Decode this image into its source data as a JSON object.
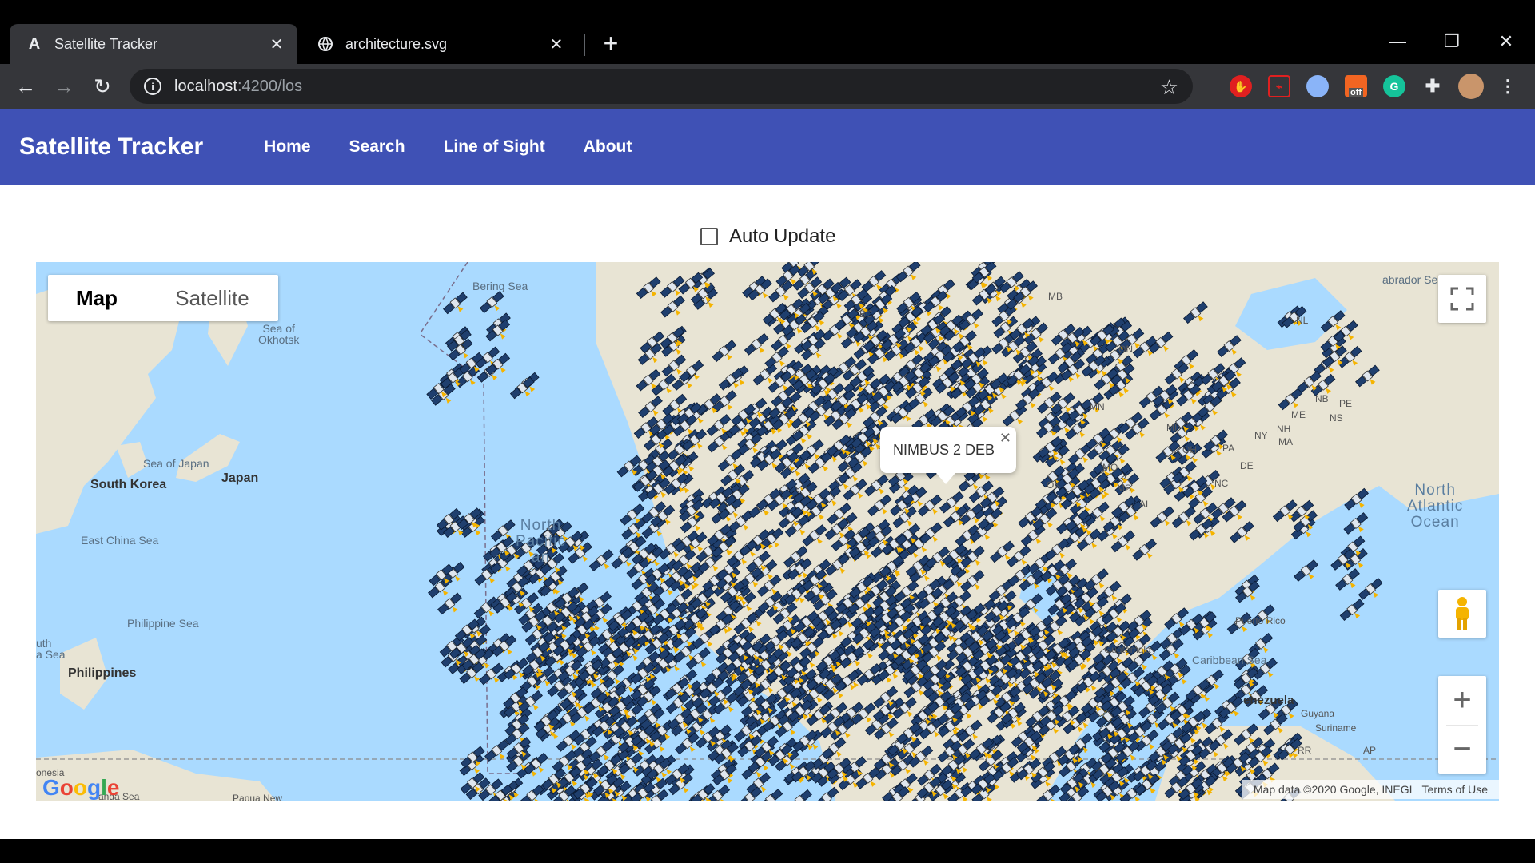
{
  "browser": {
    "tabs": [
      {
        "title": "Satellite Tracker",
        "favicon": "angular-icon",
        "active": true
      },
      {
        "title": "architecture.svg",
        "favicon": "globe-icon",
        "active": false
      }
    ],
    "url_host": "localhost",
    "url_path": ":4200/los",
    "extensions": [
      "adblock-icon",
      "pdf-icon",
      "privacy-icon",
      "extension-off-icon",
      "grammarly-icon",
      "puzzle-icon",
      "profile-avatar"
    ],
    "off_badge": "off"
  },
  "app": {
    "title": "Satellite Tracker",
    "nav": [
      "Home",
      "Search",
      "Line of Sight",
      "About"
    ],
    "auto_update_label": "Auto Update",
    "auto_update_checked": false
  },
  "map": {
    "type_control": {
      "map": "Map",
      "satellite": "Satellite",
      "selected": "Map"
    },
    "info_window": "NIMBUS 2 DEB",
    "labels": {
      "bering_sea": "Bering Sea",
      "okhotsk": "Sea of\nOkhotsk",
      "sea_of_japan": "Sea of Japan",
      "japan": "Japan",
      "south_korea": "South Korea",
      "east_china_sea": "East China Sea",
      "philippine_sea": "Philippine Sea",
      "philippines": "Philippines",
      "south_china_sea": "uth\na Sea",
      "north_pacific": "North\nPacific\nan",
      "north_atlantic": "North\nAtlantic\nOcean",
      "labrador_sea": "abrador Sea",
      "guatemala": "Guatemala",
      "caribbean": "Caribbean Sea",
      "venezuela": "enezuela",
      "guyana": "Guyana",
      "suriname": "Suriname",
      "puerto_rico": "Puerto Rico",
      "indonesia": "onesia",
      "banda_sea": "anda Sea",
      "papua": "Papua New",
      "on": "ON",
      "bc": "BC",
      "mb": "MB",
      "nl": "NL",
      "nb": "NB",
      "pe": "PE",
      "ns": "NS",
      "me": "ME",
      "ny": "NY",
      "nh": "NH",
      "ma": "MA",
      "pa": "PA",
      "oh": "OH",
      "mi": "MI",
      "mn": "MN",
      "mo": "MO",
      "ok": "OK",
      "nc": "NC",
      "al": "AL",
      "ms": "MS",
      "de": "DE",
      "rr": "RR",
      "ap": "AP"
    },
    "google": "Google",
    "attribution": [
      "Map data ©2020 Google, INEGI",
      "Terms of Use"
    ]
  },
  "colors": {
    "appbar": "#3f51b5",
    "water": "#aadaff",
    "land": "#e8e4d4",
    "satellite_body": "#1f3f6e",
    "satellite_wing": "#f5b400"
  }
}
